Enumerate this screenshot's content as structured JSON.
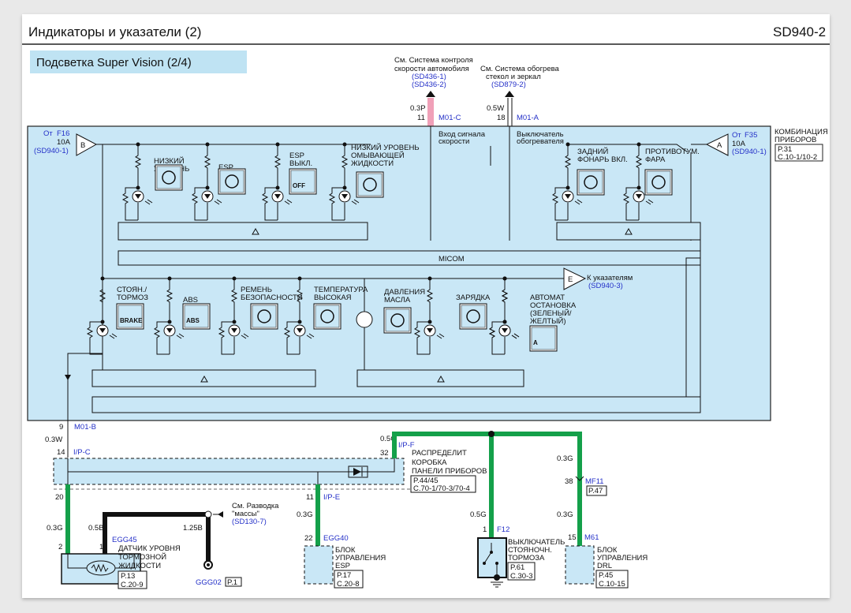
{
  "header": {
    "title": "Индикаторы и указатели (2)",
    "code": "SD940-2"
  },
  "section_title": "Подсветка Super Vision (2/4)",
  "colors": {
    "module_fill": "#c9e7f6",
    "wire_green": "#14a04a",
    "wire_pink": "#f0a0b8",
    "link_blue": "#2430c8",
    "wire_black": "#111111"
  },
  "top_refs": {
    "speed": {
      "lines": [
        "См. Система контроля",
        "скорости автомобиля"
      ],
      "refs": [
        "(SD436-1)",
        "(SD436-2)"
      ],
      "wire": "0.3P",
      "pin": "11",
      "connector": "M01-C",
      "inner": [
        "Вход сигнала",
        "скорости"
      ]
    },
    "heater": {
      "lines": [
        "См. Система обогрева",
        "стекол и зеркал"
      ],
      "refs": [
        "(SD879-2)"
      ],
      "wire": "0.5W",
      "pin": "18",
      "connector": "M01-A",
      "inner": [
        "Выключатель",
        "обогревателя"
      ]
    }
  },
  "module": {
    "name": [
      "КОМБИНАЦИЯ",
      "ПРИБОРОВ"
    ],
    "page_ref": [
      "P.31",
      "C.10-1/10-2"
    ],
    "micom": "MICOM"
  },
  "inputs": {
    "b": {
      "letter": "B",
      "from": "От",
      "fuse": "F16",
      "amp": "10A",
      "ref": "(SD940-1)"
    },
    "a": {
      "letter": "A",
      "from": "От",
      "fuse": "F35",
      "amp": "10A",
      "ref": "(SD940-1)"
    },
    "e": {
      "letter": "E",
      "text": "К указателям",
      "ref": "(SD940-3)"
    }
  },
  "indicators_row1": [
    {
      "label": [
        "НИЗКИЙ",
        "УРОВЕНЬ"
      ],
      "icon": "fuel-pump-icon"
    },
    {
      "label": [
        "ESP"
      ],
      "icon": "esp-skid-icon"
    },
    {
      "label": [
        "ESP",
        "ВЫКЛ."
      ],
      "icon": "esp-off-icon",
      "icon_text": "OFF"
    },
    {
      "label": [
        "НИЗКИЙ УРОВЕНЬ",
        "ОМЫВАЮЩЕЙ",
        "ЖИДКОСТИ"
      ],
      "icon": "washer-fluid-icon"
    },
    {
      "label": [
        "ЗАДНИЙ",
        "ФОНАРЬ ВКЛ."
      ],
      "icon": "rear-fog-icon"
    },
    {
      "label": [
        "ПРОТИВОТУМ.",
        "ФАРА"
      ],
      "icon": "front-fog-icon"
    }
  ],
  "indicators_row2": [
    {
      "label": [
        "СТОЯН./",
        "ТОРМОЗ"
      ],
      "icon": "parking-brake-icon",
      "icon_text": "BRAKE"
    },
    {
      "label": [
        "ABS"
      ],
      "icon": "abs-icon",
      "icon_text": "ABS"
    },
    {
      "label": [
        "РЕМЕНЬ",
        "БЕЗОПАСНОСТИ"
      ],
      "icon": "seatbelt-icon"
    },
    {
      "label": [
        "ТЕМПЕРАТУРА",
        "ВЫСОКАЯ"
      ],
      "icon": "coolant-temp-icon"
    },
    {
      "label": [
        "ДАВЛЕНИЯ",
        "МАСЛА"
      ],
      "icon": "oil-can-icon"
    },
    {
      "label": [
        "ЗАРЯДКА"
      ],
      "icon": "battery-icon"
    },
    {
      "label": [
        "АВТОМАТ",
        "ОСТАНОВКА",
        "(ЗЕЛЕНЫЙ/",
        "ЖЕЛТЫЙ)"
      ],
      "icon": "auto-stop-icon",
      "icon_text": "A"
    }
  ],
  "wiring": {
    "m01b": {
      "pin": "9",
      "connector": "M01-B",
      "wire": "0.3W"
    },
    "ipc": {
      "pin": "14",
      "connector": "I/P-C",
      "pin_out": "20"
    },
    "ipe": {
      "pin": "11",
      "connector": "I/P-E"
    },
    "ipf": {
      "pin": "32",
      "connector": "I/P-F",
      "wire": "0.5G"
    },
    "junction_box": {
      "lines": [
        "РАСПРЕДЕЛИТ",
        "КОРОБКА",
        "ПАНЕЛИ ПРИБОРОВ"
      ],
      "page_ref": [
        "P.44/45",
        "C.70-1/70-3/70-4"
      ]
    },
    "brake_sensor": {
      "connector": "EGG45",
      "pin_a": "2",
      "pin_b": "1",
      "wire_a": "0.3G",
      "wire_b": "0.5B",
      "lines": [
        "ДАТЧИК УРОВНЯ",
        "ТОРМОЗНОЙ",
        "ЖИДКОСТИ"
      ],
      "page_ref": [
        "P.13",
        "C.20-9"
      ]
    },
    "ground": {
      "wire": "1.25B",
      "lines": [
        "См. Разводка",
        "\"массы\""
      ],
      "ref": "(SD130-7)",
      "name": "GGG02",
      "page_ref": "P.1"
    },
    "esp_unit": {
      "connector": "EGG40",
      "pin": "22",
      "wire": "0.3G",
      "lines": [
        "БЛОК",
        "УПРАВЛЕНИЯ",
        "ESP"
      ],
      "page_ref": [
        "P.17",
        "C.20-8"
      ]
    },
    "park_switch": {
      "connector": "F12",
      "pin": "1",
      "wire": "0.5G",
      "lines": [
        "ВЫКЛЮЧАТЕЛЬ",
        "СТОЯНОЧН.",
        "ТОРМОЗА"
      ],
      "page_ref": [
        "P.61",
        "C.30-3"
      ]
    },
    "mf11": {
      "connector": "MF11",
      "pin": "38",
      "wire_in": "0.3G",
      "wire_out": "0.3G",
      "page_ref": "P.47"
    },
    "drl_unit": {
      "connector": "M61",
      "pin": "15",
      "lines": [
        "БЛОК",
        "УПРАВЛЕНИЯ",
        "DRL"
      ],
      "page_ref": [
        "P.45",
        "C.10-15"
      ]
    }
  }
}
